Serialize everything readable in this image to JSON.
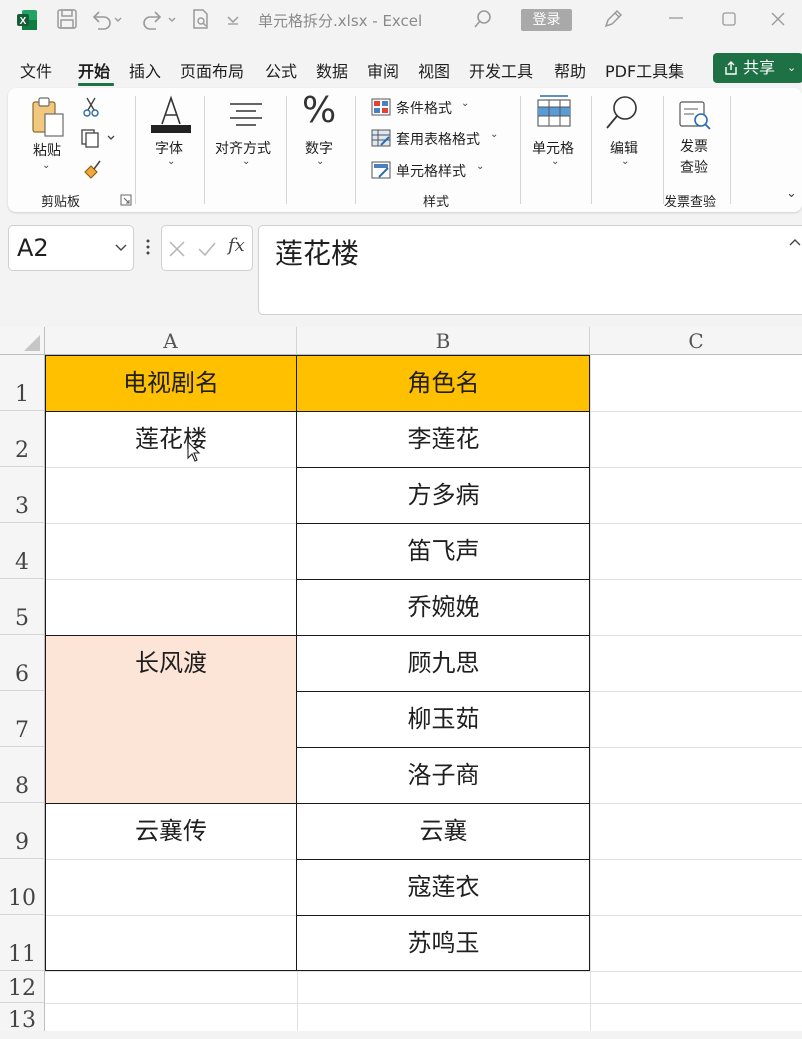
{
  "window": {
    "title": "单元格拆分.xlsx  -  Excel",
    "login_label": "登录"
  },
  "menu": {
    "tabs": [
      "文件",
      "开始",
      "插入",
      "页面布局",
      "公式",
      "数据",
      "审阅",
      "视图",
      "开发工具",
      "帮助",
      "PDF工具集"
    ],
    "active_tab": "开始",
    "share_label": "共享"
  },
  "ribbon": {
    "paste_label": "粘贴",
    "clipboard_group": "剪贴板",
    "font_label": "字体",
    "align_label": "对齐方式",
    "number_label": "数字",
    "cond_format_label": "条件格式",
    "table_format_label": "套用表格格式",
    "cell_style_label": "单元格样式",
    "styles_group": "样式",
    "cells_label": "单元格",
    "edit_label": "编辑",
    "invoice_btn_line1": "发票",
    "invoice_btn_line2": "查验",
    "invoice_group": "发票查验"
  },
  "formula_bar": {
    "name_box": "A2",
    "fx_label": "fx",
    "value": "莲花楼"
  },
  "sheet": {
    "columns": [
      "A",
      "B",
      "C"
    ],
    "rows": [
      "1",
      "2",
      "3",
      "4",
      "5",
      "6",
      "7",
      "8",
      "9",
      "10",
      "11",
      "12",
      "13"
    ],
    "header_a": "电视剧名",
    "header_b": "角色名",
    "header_fill": "#ffc000",
    "selection_fill": "#fce4d6",
    "shows": [
      "莲花楼",
      "长风渡",
      "云襄传"
    ],
    "characters": [
      "李莲花",
      "方多病",
      "笛飞声",
      "乔婉娩",
      "顾九思",
      "柳玉茹",
      "洛子商",
      "云襄",
      "寇莲衣",
      "苏鸣玉"
    ]
  },
  "colors": {
    "accent": "#1e7145"
  }
}
